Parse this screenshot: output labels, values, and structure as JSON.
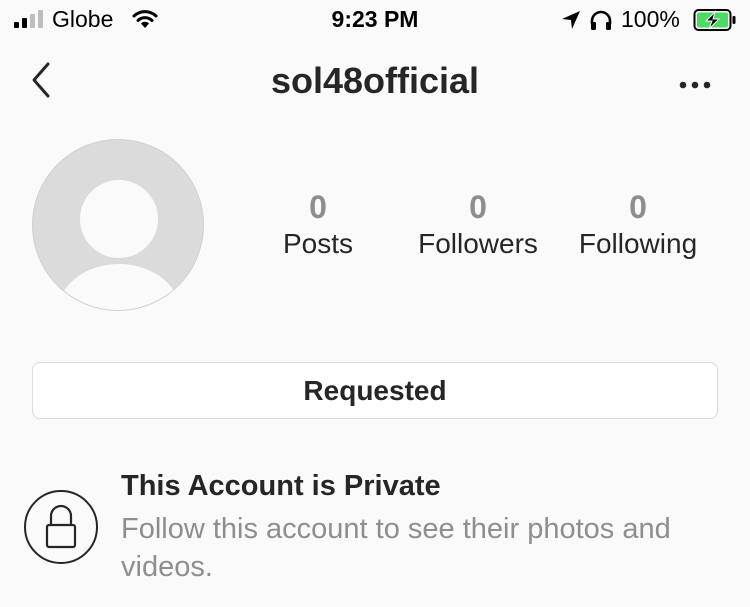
{
  "status_bar": {
    "carrier": "Globe",
    "time": "9:23 PM",
    "battery_percent": "100%",
    "signal_bars_active": 2,
    "signal_bars_total": 4,
    "battery_charging": true
  },
  "nav": {
    "username": "sol48official",
    "back_icon": "chevron-left-icon",
    "more_icon": "more-horizontal-icon"
  },
  "profile": {
    "avatar_icon": "default-avatar-icon",
    "stats": [
      {
        "value": "0",
        "label": "Posts"
      },
      {
        "value": "0",
        "label": "Followers"
      },
      {
        "value": "0",
        "label": "Following"
      }
    ]
  },
  "actions": {
    "requested_label": "Requested"
  },
  "private_notice": {
    "icon": "lock-icon",
    "title": "This Account is Private",
    "description": "Follow this account to see their photos and videos."
  },
  "colors": {
    "background": "#fafafa",
    "text_primary": "#262626",
    "text_secondary": "#8e8e8e",
    "border": "#dbdbdb",
    "battery_green": "#4cd964"
  }
}
